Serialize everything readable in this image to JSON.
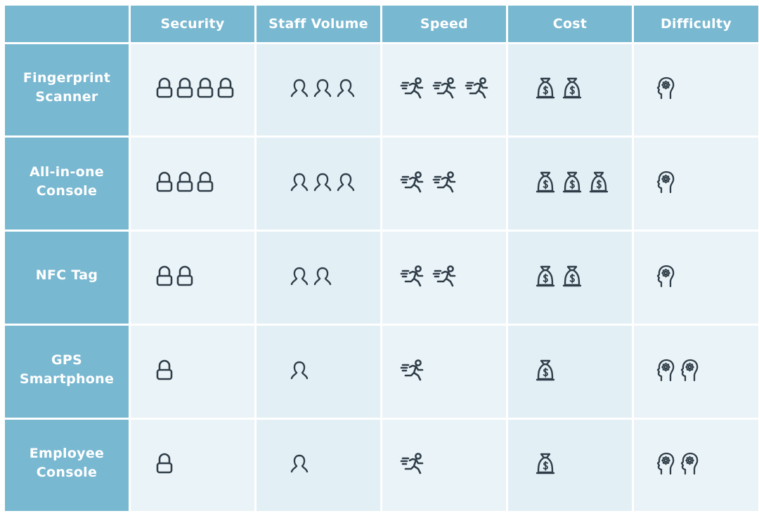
{
  "table": {
    "corner_label": "",
    "columns": [
      {
        "key": "security",
        "label": "Security",
        "icon": "lock-icon"
      },
      {
        "key": "staff",
        "label": "Staff Volume",
        "icon": "person-icon"
      },
      {
        "key": "speed",
        "label": "Speed",
        "icon": "running-person-icon"
      },
      {
        "key": "cost",
        "label": "Cost",
        "icon": "money-bag-icon"
      },
      {
        "key": "difficulty",
        "label": "Difficulty",
        "icon": "head-gear-icon"
      }
    ],
    "rows": [
      {
        "label_line1": "Fingerprint",
        "label_line2": "Scanner",
        "security": 4,
        "staff": 3,
        "speed": 3,
        "cost": 2,
        "difficulty": 1
      },
      {
        "label_line1": "All-in-one",
        "label_line2": "Console",
        "security": 3,
        "staff": 3,
        "speed": 2,
        "cost": 3,
        "difficulty": 1
      },
      {
        "label_line1": "NFC Tag",
        "label_line2": "",
        "security": 2,
        "staff": 2,
        "speed": 2,
        "cost": 2,
        "difficulty": 1
      },
      {
        "label_line1": "GPS",
        "label_line2": "Smartphone",
        "security": 1,
        "staff": 1,
        "speed": 1,
        "cost": 1,
        "difficulty": 2
      },
      {
        "label_line1": "Employee",
        "label_line2": "Console",
        "security": 1,
        "staff": 1,
        "speed": 1,
        "cost": 1,
        "difficulty": 2
      }
    ]
  },
  "colors": {
    "header_bg": "#79b8d1",
    "header_text": "#ffffff",
    "cell_light": "#eaf3f7",
    "cell_blue": "#e2eff5",
    "icon_stroke": "#2f3d48"
  }
}
